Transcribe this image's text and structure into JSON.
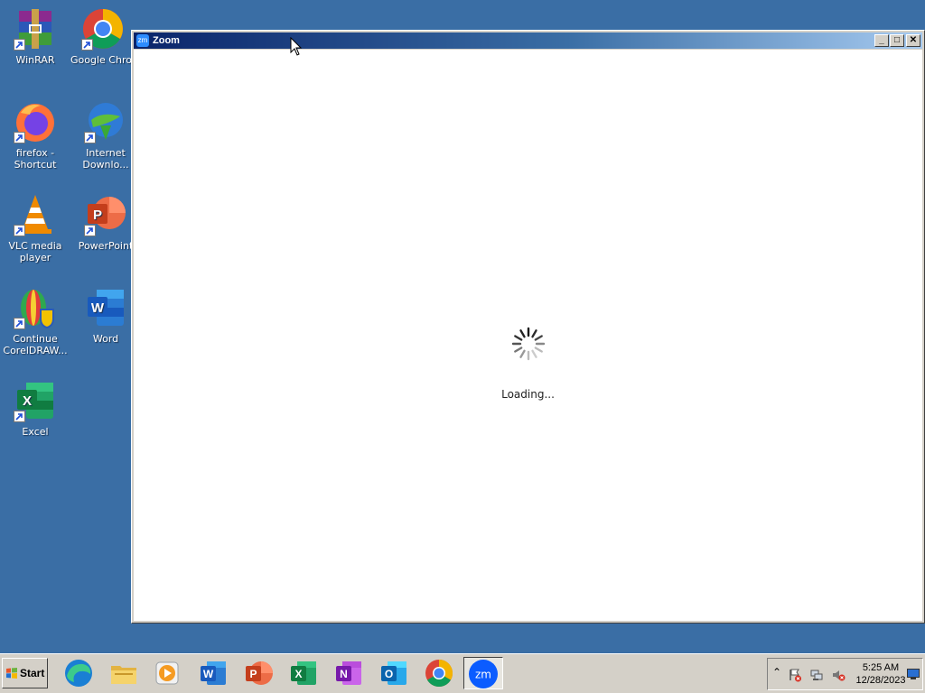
{
  "desktop": {
    "icons": [
      {
        "label": "WinRAR"
      },
      {
        "label": "Google Chrome"
      },
      {
        "label": "firefox - Shortcut"
      },
      {
        "label": "Internet Downlo..."
      },
      {
        "label": "VLC media player"
      },
      {
        "label": "PowerPoint"
      },
      {
        "label": "Continue CorelDRAW..."
      },
      {
        "label": "Word"
      },
      {
        "label": "Excel"
      }
    ]
  },
  "window": {
    "title": "Zoom",
    "logo_text": "zm",
    "minimize_glyph": "_",
    "maximize_glyph": "□",
    "close_glyph": "✕",
    "loading_text": "Loading..."
  },
  "taskbar": {
    "start_label": "Start",
    "apps": [
      {
        "icon": "edge-icon"
      },
      {
        "icon": "file-explorer-icon"
      },
      {
        "icon": "media-player-icon"
      },
      {
        "icon": "word-icon"
      },
      {
        "icon": "powerpoint-icon"
      },
      {
        "icon": "excel-icon"
      },
      {
        "icon": "onenote-icon"
      },
      {
        "icon": "outlook-icon"
      },
      {
        "icon": "chrome-icon"
      },
      {
        "icon": "zoom-icon",
        "label": "zm"
      }
    ],
    "tray": {
      "chevron": "⌃",
      "time": "5:25 AM",
      "date": "12/28/2023"
    }
  },
  "colors": {
    "desktop": "#3a6ea5",
    "titlebar_start": "#0a246a",
    "titlebar_end": "#a6caf0",
    "zoom_blue": "#2d8cff"
  }
}
